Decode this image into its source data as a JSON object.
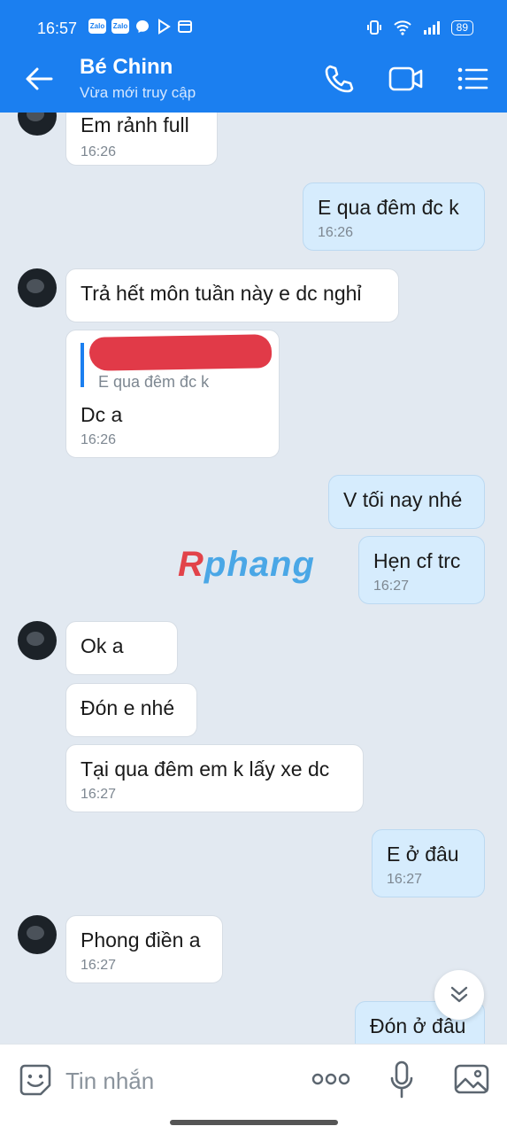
{
  "status": {
    "time": "16:57",
    "battery": "89",
    "app_badges": [
      "Zalo",
      "Zalo"
    ]
  },
  "header": {
    "contact_name": "Bé Chinn",
    "presence": "Vừa mới truy cập"
  },
  "messages": [
    {
      "dir": "in",
      "text": "Em rảnh full",
      "time": "16:26"
    },
    {
      "dir": "out",
      "text": "E qua đêm đc k",
      "time": "16:26"
    },
    {
      "dir": "in",
      "text": "Trả hết môn tuần này e dc nghỉ",
      "time": ""
    },
    {
      "dir": "in",
      "quote": "E qua đêm đc k",
      "text": "Dc a",
      "time": "16:26"
    },
    {
      "dir": "out",
      "text": "V tối nay nhé",
      "time": ""
    },
    {
      "dir": "out",
      "text": "Hẹn cf trc",
      "time": "16:27"
    },
    {
      "dir": "in",
      "text": "Ok a",
      "time": ""
    },
    {
      "dir": "in",
      "text": "Đón e nhé",
      "time": ""
    },
    {
      "dir": "in",
      "text": "Tại qua đêm em k lấy xe dc",
      "time": "16:27"
    },
    {
      "dir": "out",
      "text": "E ở đâu",
      "time": "16:27"
    },
    {
      "dir": "in",
      "text": "Phong điền a",
      "time": "16:27"
    },
    {
      "dir": "out",
      "text": "Đón ở đâu",
      "time": ""
    }
  ],
  "watermark": {
    "first": "R",
    "rest": "phang"
  },
  "composer": {
    "placeholder": "Tin nhắn"
  },
  "icons": {
    "back": "back-arrow-icon",
    "call": "phone-icon",
    "video": "video-icon",
    "menu": "menu-icon",
    "sticker": "sticker-icon",
    "more": "more-icon",
    "mic": "mic-icon",
    "image": "image-icon",
    "scroll": "scroll-down-icon"
  },
  "colors": {
    "brand": "#1b7ff0",
    "outgoing_bubble": "#d6ecfd",
    "chat_bg": "#e2e9f1"
  }
}
